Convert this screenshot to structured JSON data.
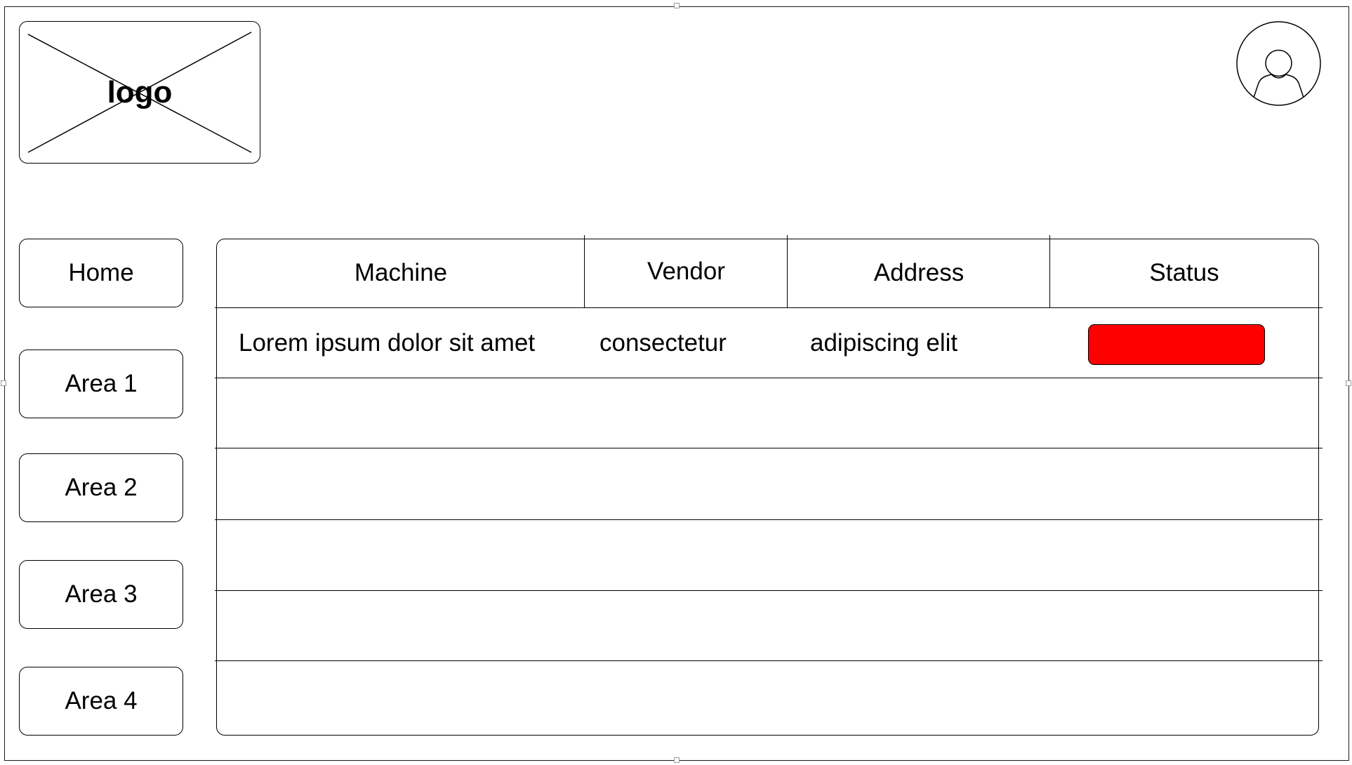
{
  "header": {
    "logo_text": "logo",
    "avatar_icon": "user-avatar-icon"
  },
  "sidebar": {
    "items": [
      {
        "label": "Home"
      },
      {
        "label": "Area 1"
      },
      {
        "label": "Area 2"
      },
      {
        "label": "Area 3"
      },
      {
        "label": "Area 4"
      }
    ]
  },
  "table": {
    "columns": [
      "Machine",
      "Vendor",
      "Address",
      "Status"
    ],
    "rows": [
      {
        "machine": "Lorem ipsum dolor sit amet",
        "vendor": "consectetur",
        "address": "adipiscing elit",
        "status_color": "#ff0000"
      },
      {
        "machine": "",
        "vendor": "",
        "address": "",
        "status_color": ""
      },
      {
        "machine": "",
        "vendor": "",
        "address": "",
        "status_color": ""
      },
      {
        "machine": "",
        "vendor": "",
        "address": "",
        "status_color": ""
      },
      {
        "machine": "",
        "vendor": "",
        "address": "",
        "status_color": ""
      }
    ]
  },
  "colors": {
    "status_alert": "#ff0000",
    "stroke": "#000000",
    "background": "#ffffff"
  }
}
